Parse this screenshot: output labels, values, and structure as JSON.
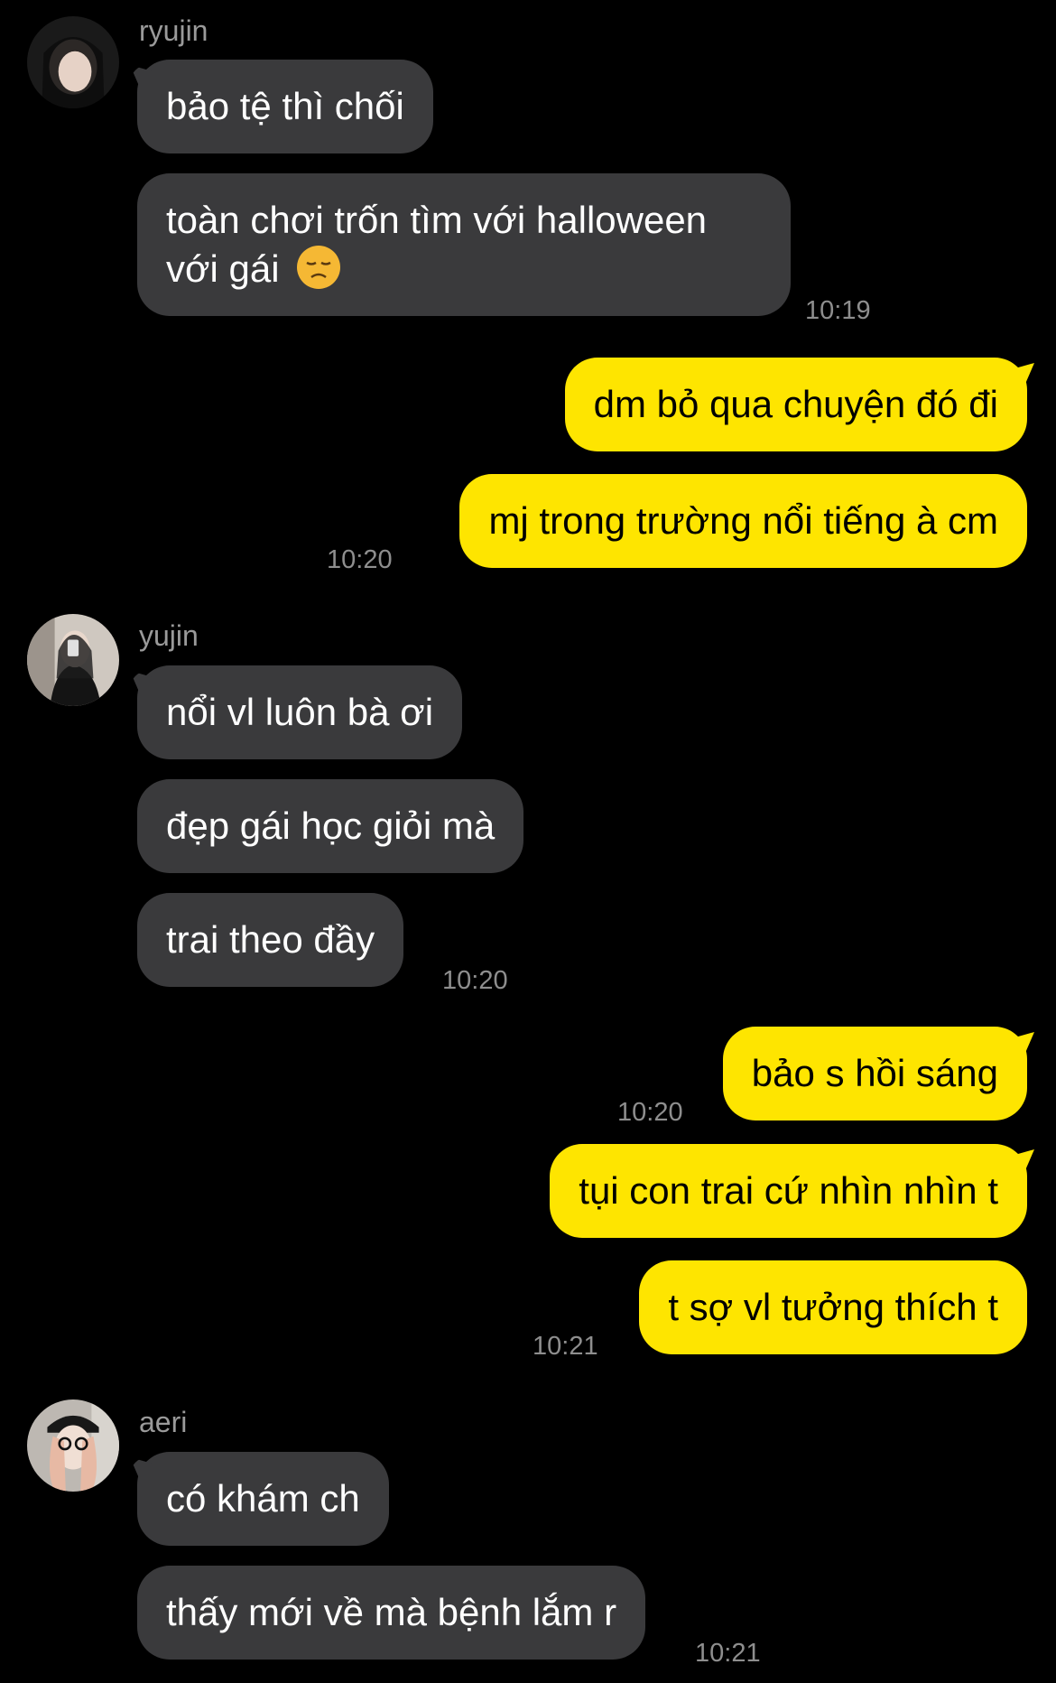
{
  "messages": {
    "ryujin": {
      "name": "ryujin",
      "m1": "bảo tệ thì chối",
      "m2_line1": "toàn chơi trốn tìm với halloween",
      "m2_line2": "với gái",
      "m2_emoji": "disappointed-face-icon",
      "time": "10:19"
    },
    "me1": {
      "m1": "dm bỏ qua chuyện đó đi",
      "m2": "mj trong trường nổi tiếng à cm",
      "time": "10:20"
    },
    "yujin": {
      "name": "yujin",
      "m1": "nổi vl luôn bà ơi",
      "m2": "đẹp gái học giỏi mà",
      "m3": "trai theo đầy",
      "time": "10:20"
    },
    "me2": {
      "m1": "bảo s hồi sáng",
      "m1_time": "10:20",
      "m2": "tụi con trai cứ nhìn nhìn t",
      "m3": "t sợ vl tưởng thích t",
      "time": "10:21"
    },
    "aeri": {
      "name": "aeri",
      "m1": "có khám ch",
      "m2": "thấy mới về mà bệnh lắm r",
      "time": "10:21"
    }
  },
  "colors": {
    "background": "#000000",
    "incoming_bubble": "#3a3a3c",
    "outgoing_bubble": "#fee500",
    "timestamp": "#8e8e8e"
  }
}
